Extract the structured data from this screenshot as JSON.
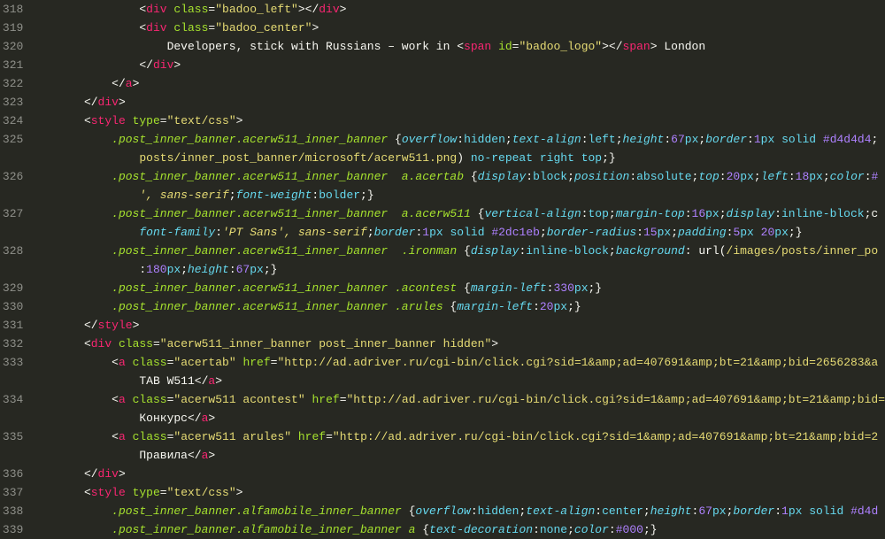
{
  "gutter": [
    "318",
    "319",
    "320",
    "321",
    "322",
    "323",
    "324",
    "325",
    "",
    "326",
    "",
    "327",
    "",
    "328",
    "",
    "329",
    "330",
    "331",
    "332",
    "333",
    "",
    "334",
    "",
    "335",
    "",
    "336",
    "337",
    "338",
    "339"
  ],
  "lines": [
    {
      "indent": 15,
      "t": [
        [
          "c-punc",
          "<"
        ],
        [
          "c-tag",
          "div"
        ],
        [
          "c-text",
          " "
        ],
        [
          "c-attr",
          "class"
        ],
        [
          "c-punc",
          "="
        ],
        [
          "c-str",
          "\"badoo_left\""
        ],
        [
          "c-punc",
          "></"
        ],
        [
          "c-tag",
          "div"
        ],
        [
          "c-punc",
          ">"
        ]
      ]
    },
    {
      "indent": 15,
      "t": [
        [
          "c-punc",
          "<"
        ],
        [
          "c-tag",
          "div"
        ],
        [
          "c-text",
          " "
        ],
        [
          "c-attr",
          "class"
        ],
        [
          "c-punc",
          "="
        ],
        [
          "c-str",
          "\"badoo_center\""
        ],
        [
          "c-punc",
          ">"
        ]
      ]
    },
    {
      "indent": 19,
      "t": [
        [
          "c-text",
          "Developers, stick with Russians – work in "
        ],
        [
          "c-punc",
          "<"
        ],
        [
          "c-tag",
          "span"
        ],
        [
          "c-text",
          " "
        ],
        [
          "c-attr",
          "id"
        ],
        [
          "c-punc",
          "="
        ],
        [
          "c-str",
          "\"badoo_logo\""
        ],
        [
          "c-punc",
          "></"
        ],
        [
          "c-tag",
          "span"
        ],
        [
          "c-punc",
          ">"
        ],
        [
          "c-text",
          " London"
        ]
      ]
    },
    {
      "indent": 15,
      "t": [
        [
          "c-punc",
          "</"
        ],
        [
          "c-tag",
          "div"
        ],
        [
          "c-punc",
          ">"
        ]
      ]
    },
    {
      "indent": 11,
      "t": [
        [
          "c-punc",
          "</"
        ],
        [
          "c-tag",
          "a"
        ],
        [
          "c-punc",
          ">"
        ]
      ]
    },
    {
      "indent": 7,
      "t": [
        [
          "c-punc",
          "</"
        ],
        [
          "c-tag",
          "div"
        ],
        [
          "c-punc",
          ">"
        ]
      ]
    },
    {
      "indent": 7,
      "t": [
        [
          "c-punc",
          "<"
        ],
        [
          "c-tag",
          "style"
        ],
        [
          "c-text",
          " "
        ],
        [
          "c-attr",
          "type"
        ],
        [
          "c-punc",
          "="
        ],
        [
          "c-str",
          "\"text/css\""
        ],
        [
          "c-punc",
          ">"
        ]
      ]
    },
    {
      "indent": 11,
      "t": [
        [
          "c-sel",
          ".post_inner_banner.acerw511_inner_banner"
        ],
        [
          "c-text",
          " {"
        ],
        [
          "c-prop",
          "overflow"
        ],
        [
          "c-text",
          ":"
        ],
        [
          "c-val",
          "hidden"
        ],
        [
          "c-text",
          ";"
        ],
        [
          "c-prop",
          "text-align"
        ],
        [
          "c-text",
          ":"
        ],
        [
          "c-val",
          "left"
        ],
        [
          "c-text",
          ";"
        ],
        [
          "c-prop",
          "height"
        ],
        [
          "c-text",
          ":"
        ],
        [
          "c-num",
          "67"
        ],
        [
          "c-val",
          "px"
        ],
        [
          "c-text",
          ";"
        ],
        [
          "c-prop",
          "border"
        ],
        [
          "c-text",
          ":"
        ],
        [
          "c-num",
          "1"
        ],
        [
          "c-val",
          "px"
        ],
        [
          "c-text",
          " "
        ],
        [
          "c-val",
          "solid"
        ],
        [
          "c-text",
          " "
        ],
        [
          "c-num",
          "#d4d4d4"
        ],
        [
          "c-text",
          ";"
        ]
      ]
    },
    {
      "indent": 15,
      "t": [
        [
          "c-url",
          "posts/inner_post_banner/microsoft/acerw511.png"
        ],
        [
          "c-text",
          ") "
        ],
        [
          "c-val",
          "no-repeat"
        ],
        [
          "c-text",
          " "
        ],
        [
          "c-val",
          "right"
        ],
        [
          "c-text",
          " "
        ],
        [
          "c-val",
          "top"
        ],
        [
          "c-text",
          ";}"
        ]
      ]
    },
    {
      "indent": 11,
      "t": [
        [
          "c-sel",
          ".post_inner_banner.acerw511_inner_banner  a.acertab"
        ],
        [
          "c-text",
          " {"
        ],
        [
          "c-prop",
          "display"
        ],
        [
          "c-text",
          ":"
        ],
        [
          "c-val",
          "block"
        ],
        [
          "c-text",
          ";"
        ],
        [
          "c-prop",
          "position"
        ],
        [
          "c-text",
          ":"
        ],
        [
          "c-val",
          "absolute"
        ],
        [
          "c-text",
          ";"
        ],
        [
          "c-prop",
          "top"
        ],
        [
          "c-text",
          ":"
        ],
        [
          "c-num",
          "20"
        ],
        [
          "c-val",
          "px"
        ],
        [
          "c-text",
          ";"
        ],
        [
          "c-prop",
          "left"
        ],
        [
          "c-text",
          ":"
        ],
        [
          "c-num",
          "18"
        ],
        [
          "c-val",
          "px"
        ],
        [
          "c-text",
          ";"
        ],
        [
          "c-prop",
          "color"
        ],
        [
          "c-text",
          ":"
        ],
        [
          "c-num",
          "#"
        ]
      ]
    },
    {
      "indent": 15,
      "t": [
        [
          "c-strit",
          "', sans-serif"
        ],
        [
          "c-text",
          ";"
        ],
        [
          "c-prop",
          "font-weight"
        ],
        [
          "c-text",
          ":"
        ],
        [
          "c-val",
          "bolder"
        ],
        [
          "c-text",
          ";}"
        ]
      ]
    },
    {
      "indent": 11,
      "t": [
        [
          "c-sel",
          ".post_inner_banner.acerw511_inner_banner  a.acerw511"
        ],
        [
          "c-text",
          " {"
        ],
        [
          "c-prop",
          "vertical-align"
        ],
        [
          "c-text",
          ":"
        ],
        [
          "c-val",
          "top"
        ],
        [
          "c-text",
          ";"
        ],
        [
          "c-prop",
          "margin-top"
        ],
        [
          "c-text",
          ":"
        ],
        [
          "c-num",
          "16"
        ],
        [
          "c-val",
          "px"
        ],
        [
          "c-text",
          ";"
        ],
        [
          "c-prop",
          "display"
        ],
        [
          "c-text",
          ":"
        ],
        [
          "c-val",
          "inline-block"
        ],
        [
          "c-text",
          ";c"
        ]
      ]
    },
    {
      "indent": 15,
      "t": [
        [
          "c-prop",
          "font-family"
        ],
        [
          "c-text",
          ":"
        ],
        [
          "c-strit",
          "'PT Sans', sans-serif"
        ],
        [
          "c-text",
          ";"
        ],
        [
          "c-prop",
          "border"
        ],
        [
          "c-text",
          ":"
        ],
        [
          "c-num",
          "1"
        ],
        [
          "c-val",
          "px"
        ],
        [
          "c-text",
          " "
        ],
        [
          "c-val",
          "solid"
        ],
        [
          "c-text",
          " "
        ],
        [
          "c-num",
          "#2dc1eb"
        ],
        [
          "c-text",
          ";"
        ],
        [
          "c-prop",
          "border-radius"
        ],
        [
          "c-text",
          ":"
        ],
        [
          "c-num",
          "15"
        ],
        [
          "c-val",
          "px"
        ],
        [
          "c-text",
          ";"
        ],
        [
          "c-prop",
          "padding"
        ],
        [
          "c-text",
          ":"
        ],
        [
          "c-num",
          "5"
        ],
        [
          "c-val",
          "px"
        ],
        [
          "c-text",
          " "
        ],
        [
          "c-num",
          "20"
        ],
        [
          "c-val",
          "px"
        ],
        [
          "c-text",
          ";}"
        ]
      ]
    },
    {
      "indent": 11,
      "t": [
        [
          "c-sel",
          ".post_inner_banner.acerw511_inner_banner  .ironman"
        ],
        [
          "c-text",
          " {"
        ],
        [
          "c-prop",
          "display"
        ],
        [
          "c-text",
          ":"
        ],
        [
          "c-val",
          "inline-block"
        ],
        [
          "c-text",
          ";"
        ],
        [
          "c-prop",
          "background"
        ],
        [
          "c-text",
          ": url("
        ],
        [
          "c-url",
          "/images/posts/inner_po"
        ]
      ]
    },
    {
      "indent": 15,
      "t": [
        [
          "c-text",
          ":"
        ],
        [
          "c-num",
          "180"
        ],
        [
          "c-val",
          "px"
        ],
        [
          "c-text",
          ";"
        ],
        [
          "c-prop",
          "height"
        ],
        [
          "c-text",
          ":"
        ],
        [
          "c-num",
          "67"
        ],
        [
          "c-val",
          "px"
        ],
        [
          "c-text",
          ";}"
        ]
      ]
    },
    {
      "indent": 11,
      "t": [
        [
          "c-sel",
          ".post_inner_banner.acerw511_inner_banner .acontest"
        ],
        [
          "c-text",
          " {"
        ],
        [
          "c-prop",
          "margin-left"
        ],
        [
          "c-text",
          ":"
        ],
        [
          "c-num",
          "330"
        ],
        [
          "c-val",
          "px"
        ],
        [
          "c-text",
          ";}"
        ]
      ]
    },
    {
      "indent": 11,
      "t": [
        [
          "c-sel",
          ".post_inner_banner.acerw511_inner_banner .arules"
        ],
        [
          "c-text",
          " {"
        ],
        [
          "c-prop",
          "margin-left"
        ],
        [
          "c-text",
          ":"
        ],
        [
          "c-num",
          "20"
        ],
        [
          "c-val",
          "px"
        ],
        [
          "c-text",
          ";}"
        ]
      ]
    },
    {
      "indent": 7,
      "t": [
        [
          "c-punc",
          "</"
        ],
        [
          "c-tag",
          "style"
        ],
        [
          "c-punc",
          ">"
        ]
      ]
    },
    {
      "indent": 7,
      "t": [
        [
          "c-punc",
          "<"
        ],
        [
          "c-tag",
          "div"
        ],
        [
          "c-text",
          " "
        ],
        [
          "c-attr",
          "class"
        ],
        [
          "c-punc",
          "="
        ],
        [
          "c-str",
          "\"acerw511_inner_banner post_inner_banner hidden\""
        ],
        [
          "c-punc",
          ">"
        ]
      ]
    },
    {
      "indent": 11,
      "t": [
        [
          "c-punc",
          "<"
        ],
        [
          "c-tag",
          "a"
        ],
        [
          "c-text",
          " "
        ],
        [
          "c-attr",
          "class"
        ],
        [
          "c-punc",
          "="
        ],
        [
          "c-str",
          "\"acertab\""
        ],
        [
          "c-text",
          " "
        ],
        [
          "c-attr",
          "href"
        ],
        [
          "c-punc",
          "="
        ],
        [
          "c-str",
          "\"http://ad.adriver.ru/cgi-bin/click.cgi?sid=1&amp;ad=407691&amp;bt=21&amp;bid=2656283&a"
        ]
      ]
    },
    {
      "indent": 15,
      "t": [
        [
          "c-text",
          "TAB W511"
        ],
        [
          "c-punc",
          "</"
        ],
        [
          "c-tag",
          "a"
        ],
        [
          "c-punc",
          ">"
        ]
      ]
    },
    {
      "indent": 11,
      "t": [
        [
          "c-punc",
          "<"
        ],
        [
          "c-tag",
          "a"
        ],
        [
          "c-text",
          " "
        ],
        [
          "c-attr",
          "class"
        ],
        [
          "c-punc",
          "="
        ],
        [
          "c-str",
          "\"acerw511 acontest\""
        ],
        [
          "c-text",
          " "
        ],
        [
          "c-attr",
          "href"
        ],
        [
          "c-punc",
          "="
        ],
        [
          "c-str",
          "\"http://ad.adriver.ru/cgi-bin/click.cgi?sid=1&amp;ad=407691&amp;bt=21&amp;bid="
        ]
      ]
    },
    {
      "indent": 15,
      "t": [
        [
          "c-text",
          "Конкурс"
        ],
        [
          "c-punc",
          "</"
        ],
        [
          "c-tag",
          "a"
        ],
        [
          "c-punc",
          ">"
        ]
      ]
    },
    {
      "indent": 11,
      "t": [
        [
          "c-punc",
          "<"
        ],
        [
          "c-tag",
          "a"
        ],
        [
          "c-text",
          " "
        ],
        [
          "c-attr",
          "class"
        ],
        [
          "c-punc",
          "="
        ],
        [
          "c-str",
          "\"acerw511 arules\""
        ],
        [
          "c-text",
          " "
        ],
        [
          "c-attr",
          "href"
        ],
        [
          "c-punc",
          "="
        ],
        [
          "c-str",
          "\"http://ad.adriver.ru/cgi-bin/click.cgi?sid=1&amp;ad=407691&amp;bt=21&amp;bid=2"
        ]
      ]
    },
    {
      "indent": 15,
      "t": [
        [
          "c-text",
          "Правила"
        ],
        [
          "c-punc",
          "</"
        ],
        [
          "c-tag",
          "a"
        ],
        [
          "c-punc",
          ">"
        ]
      ]
    },
    {
      "indent": 7,
      "t": [
        [
          "c-punc",
          "</"
        ],
        [
          "c-tag",
          "div"
        ],
        [
          "c-punc",
          ">"
        ]
      ]
    },
    {
      "indent": 7,
      "t": [
        [
          "c-punc",
          "<"
        ],
        [
          "c-tag",
          "style"
        ],
        [
          "c-text",
          " "
        ],
        [
          "c-attr",
          "type"
        ],
        [
          "c-punc",
          "="
        ],
        [
          "c-str",
          "\"text/css\""
        ],
        [
          "c-punc",
          ">"
        ]
      ]
    },
    {
      "indent": 11,
      "t": [
        [
          "c-sel",
          ".post_inner_banner.alfamobile_inner_banner"
        ],
        [
          "c-text",
          " {"
        ],
        [
          "c-prop",
          "overflow"
        ],
        [
          "c-text",
          ":"
        ],
        [
          "c-val",
          "hidden"
        ],
        [
          "c-text",
          ";"
        ],
        [
          "c-prop",
          "text-align"
        ],
        [
          "c-text",
          ":"
        ],
        [
          "c-val",
          "center"
        ],
        [
          "c-text",
          ";"
        ],
        [
          "c-prop",
          "height"
        ],
        [
          "c-text",
          ":"
        ],
        [
          "c-num",
          "67"
        ],
        [
          "c-val",
          "px"
        ],
        [
          "c-text",
          ";"
        ],
        [
          "c-prop",
          "border"
        ],
        [
          "c-text",
          ":"
        ],
        [
          "c-num",
          "1"
        ],
        [
          "c-val",
          "px"
        ],
        [
          "c-text",
          " "
        ],
        [
          "c-val",
          "solid"
        ],
        [
          "c-text",
          " "
        ],
        [
          "c-num",
          "#d4d"
        ]
      ]
    },
    {
      "indent": 11,
      "t": [
        [
          "c-sel",
          ".post_inner_banner.alfamobile_inner_banner a"
        ],
        [
          "c-text",
          " {"
        ],
        [
          "c-prop",
          "text-decoration"
        ],
        [
          "c-text",
          ":"
        ],
        [
          "c-val",
          "none"
        ],
        [
          "c-text",
          ";"
        ],
        [
          "c-prop",
          "color"
        ],
        [
          "c-text",
          ":"
        ],
        [
          "c-num",
          "#000"
        ],
        [
          "c-text",
          ";}"
        ]
      ]
    }
  ]
}
